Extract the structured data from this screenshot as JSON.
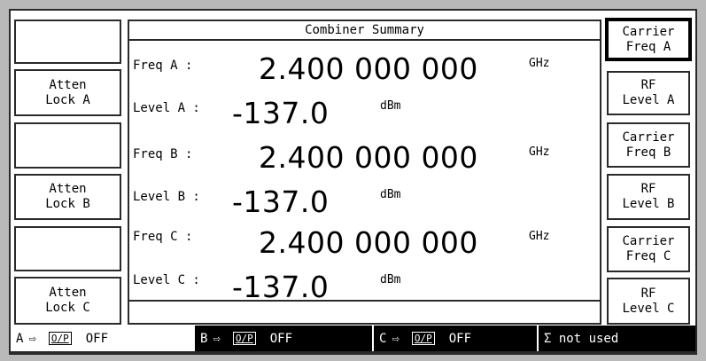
{
  "summary": {
    "title": "Combiner Summary",
    "rows": [
      {
        "freq_label": "Freq A :",
        "freq_value": "2.400 000 000",
        "freq_unit": "GHz",
        "level_label": "Level A :",
        "level_value": "-137.0",
        "level_unit": "dBm"
      },
      {
        "freq_label": "Freq B :",
        "freq_value": "2.400 000 000",
        "freq_unit": "GHz",
        "level_label": "Level B :",
        "level_value": "-137.0",
        "level_unit": "dBm"
      },
      {
        "freq_label": "Freq C :",
        "freq_value": "2.400 000 000",
        "freq_unit": "GHz",
        "level_label": "Level C :",
        "level_value": "-137.0",
        "level_unit": "dBm"
      }
    ]
  },
  "left_keys": [
    {
      "line1": "",
      "line2": ""
    },
    {
      "line1": "Atten",
      "line2": "Lock A"
    },
    {
      "line1": "",
      "line2": ""
    },
    {
      "line1": "Atten",
      "line2": "Lock B"
    },
    {
      "line1": "",
      "line2": ""
    },
    {
      "line1": "Atten",
      "line2": "Lock C"
    }
  ],
  "right_keys": [
    {
      "line1": "Carrier",
      "line2": "Freq A",
      "selected": true
    },
    {
      "line1": "RF",
      "line2": "Level A",
      "selected": false
    },
    {
      "line1": "Carrier",
      "line2": "Freq B",
      "selected": false
    },
    {
      "line1": "RF",
      "line2": "Level B",
      "selected": false
    },
    {
      "line1": "Carrier",
      "line2": "Freq C",
      "selected": false
    },
    {
      "line1": "RF",
      "line2": "Level C",
      "selected": false
    }
  ],
  "status": {
    "a": {
      "channel": "A",
      "arrow": "⇨",
      "op": "O/P",
      "state": "OFF"
    },
    "b": {
      "channel": "B",
      "arrow": "⇨",
      "op": "O/P",
      "state": "OFF"
    },
    "c": {
      "channel": "C",
      "arrow": "⇨",
      "op": "O/P",
      "state": "OFF"
    },
    "sigma": "Σ not used"
  }
}
